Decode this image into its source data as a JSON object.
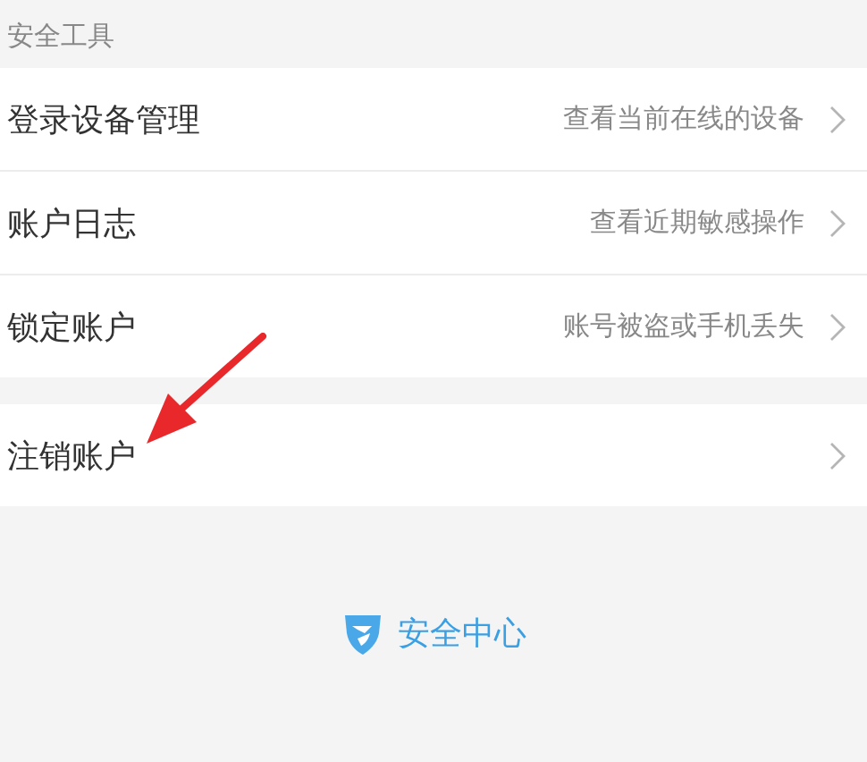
{
  "section_title": "安全工具",
  "groups": [
    {
      "items": [
        {
          "label": "登录设备管理",
          "hint": "查看当前在线的设备"
        },
        {
          "label": "账户日志",
          "hint": "查看近期敏感操作"
        },
        {
          "label": "锁定账户",
          "hint": "账号被盗或手机丢失"
        }
      ]
    },
    {
      "items": [
        {
          "label": "注销账户"
        }
      ]
    }
  ],
  "footer": {
    "brand": "安全中心"
  }
}
